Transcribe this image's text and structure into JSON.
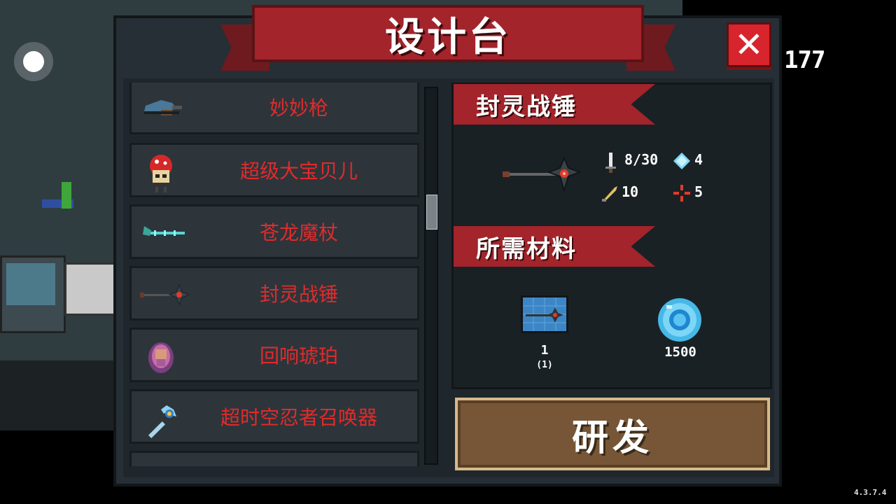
{
  "hud": {
    "coin_count": "177",
    "version": "4.3.7.4"
  },
  "panel": {
    "title": "设计台"
  },
  "list": {
    "items": [
      {
        "name": "妙妙枪",
        "icon": "blue-gun-icon"
      },
      {
        "name": "超级大宝贝儿",
        "icon": "red-mushroom-bot-icon"
      },
      {
        "name": "苍龙魔杖",
        "icon": "dragon-staff-icon"
      },
      {
        "name": "封灵战锤",
        "icon": "spirit-hammer-icon"
      },
      {
        "name": "回响琥珀",
        "icon": "echo-amber-icon"
      },
      {
        "name": "超时空忍者召唤器",
        "icon": "ninja-summoner-icon"
      }
    ]
  },
  "detail": {
    "item_name": "封灵战锤",
    "stats": {
      "damage": "8/30",
      "energy": "4",
      "crit": "10",
      "spread": "5"
    },
    "materials_title": "所需材料",
    "materials": [
      {
        "count": "1",
        "sub": "(1)",
        "icon": "blueprint-icon"
      },
      {
        "count": "1500",
        "sub": "",
        "icon": "gem-coin-icon"
      }
    ],
    "develop_label": "研发"
  },
  "colors": {
    "accent_red": "#a3242b",
    "item_text": "#e02b2b",
    "button_brown": "#765637"
  }
}
